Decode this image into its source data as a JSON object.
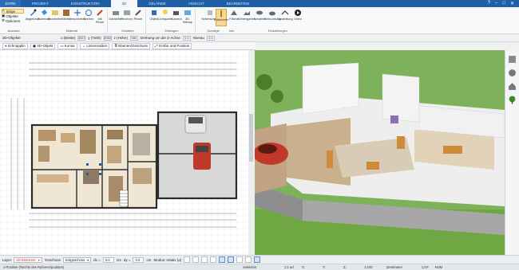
{
  "titlebar": {
    "file_tab": "DATEI",
    "tabs": [
      "PROJEKT",
      "KONSTRUKTION",
      "3D",
      "GELÄNDE",
      "ANSICHT",
      "BEARBEITEN"
    ],
    "active_tab": "3D"
  },
  "ribbon": {
    "left": {
      "select_label": "Zeige",
      "objects_label": "Objekte",
      "options_label": "Optionen"
    },
    "buttons": [
      "Abgleichen",
      "Zuweisen",
      "Bearbeiten",
      "Stellen",
      "Verschieben",
      "Drehen",
      "Mit Pinsel",
      "Darstellen",
      "Rechnen",
      "Pinsel",
      "Objekt",
      "Lichtquelle",
      "Kamera",
      "3D-Bitmap",
      "Seitenschnitt",
      "Kollisionen",
      "Fläche",
      "Wintergarten",
      "Schatten",
      "Beleuchtung",
      "Darstellung",
      "Video"
    ],
    "active_button": "Kollisionen",
    "groups": [
      "Auswahl",
      "Material",
      "Schatten",
      "Eintragen",
      "Sonstige",
      "Info",
      "Einstellungen"
    ]
  },
  "propbar": {
    "label": "3D-Objekte",
    "x_label": "x (Breite)",
    "x_value": "3057",
    "y_label": "y (Tiefe)",
    "y_value": "3983",
    "z_label": "z (Höhe)",
    "z_value": "980",
    "rotate_label": "Drehung um die Z-Achse",
    "rotate_value": "0.0",
    "level_label": "Niveau",
    "level_value": "0.0"
  },
  "toolrow": {
    "items": [
      "Schnapplin",
      "3D-Objekt",
      "Kontur",
      "Linienmaßen",
      "Ebenen/Geschoss",
      "Größe und Position"
    ]
  },
  "layerbar": {
    "layer_label": "Layer",
    "layer_value": "2D-Elemente",
    "floor_label": "Geschoss",
    "floor_value": "Erdgeschoss",
    "dx_label": "dx =",
    "dx_value": "0.0",
    "dx_unit": "cm",
    "dy_label": "dy =",
    "dy_value": "0.0",
    "dy_unit": "cm",
    "relative_label": "Modus: relativ (a)"
  },
  "statusbar": {
    "hint": "x-Position (Rechts des Referenzpunktes)",
    "selection": "Selektion",
    "ratio": "1:1 ad",
    "x_field": "X:",
    "y_field": "Y:",
    "z_field": "Z:",
    "scale": "1:100",
    "unit": "Zentimeter",
    "caps": "CAP",
    "num": "NUM"
  },
  "colors": {
    "title_blue": "#1e5fa8",
    "accent_orange": "#f5d79a",
    "wall_dark": "#2b2b2b",
    "grass": "#7ab04a",
    "sky": "#9fc3e5"
  }
}
